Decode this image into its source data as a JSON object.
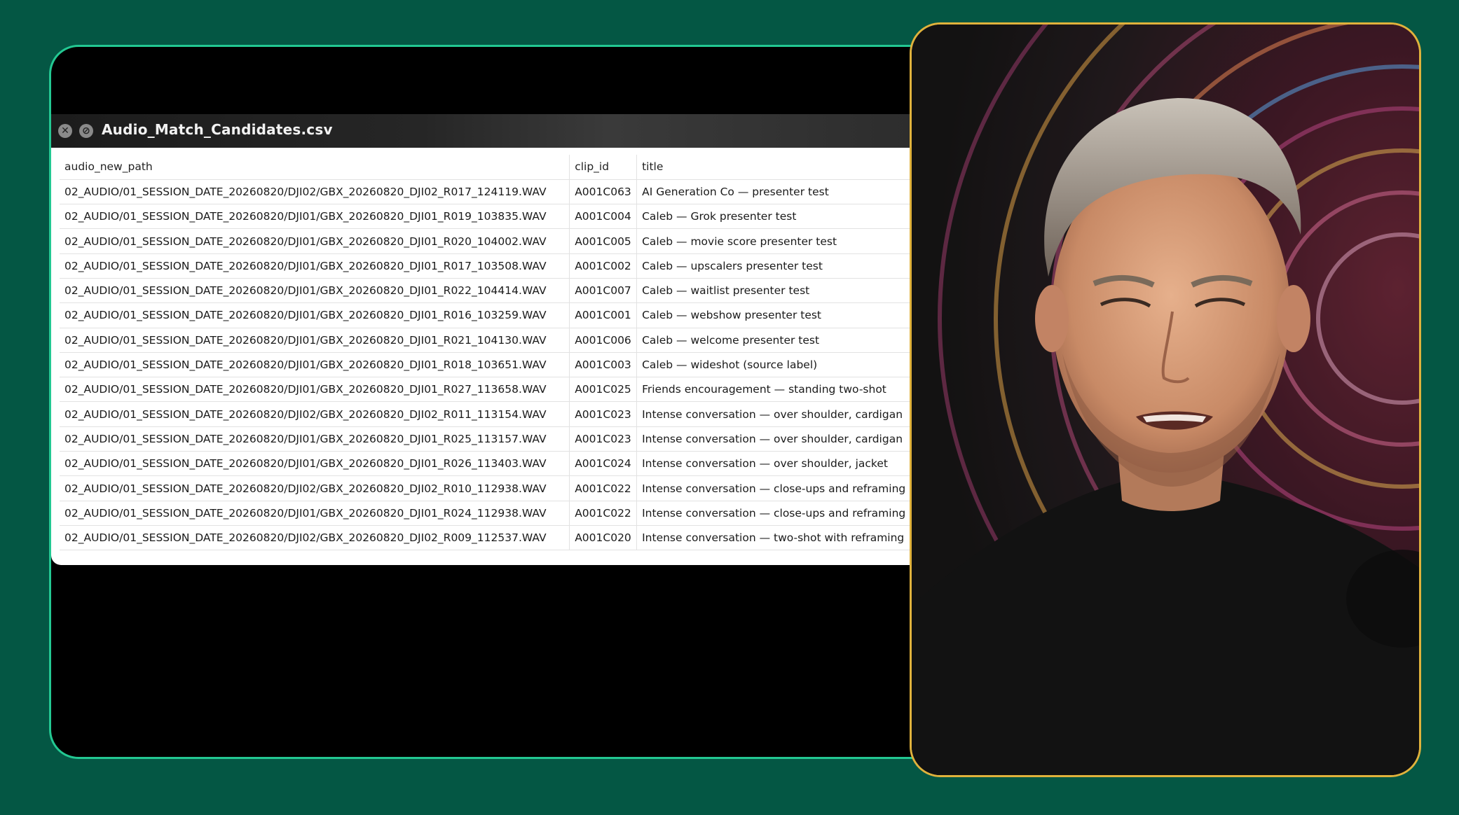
{
  "window": {
    "title": "Audio_Match_Candidates.csv",
    "close_glyph": "✕",
    "min_glyph": "⊘"
  },
  "table": {
    "headers": [
      "audio_new_path",
      "clip_id",
      "title"
    ],
    "rows": [
      [
        "02_AUDIO/01_SESSION_DATE_20260820/DJI02/GBX_20260820_DJI02_R017_124119.WAV",
        "A001C063",
        "AI Generation Co — presenter test"
      ],
      [
        "02_AUDIO/01_SESSION_DATE_20260820/DJI01/GBX_20260820_DJI01_R019_103835.WAV",
        "A001C004",
        "Caleb — Grok presenter test"
      ],
      [
        "02_AUDIO/01_SESSION_DATE_20260820/DJI01/GBX_20260820_DJI01_R020_104002.WAV",
        "A001C005",
        "Caleb — movie score presenter test"
      ],
      [
        "02_AUDIO/01_SESSION_DATE_20260820/DJI01/GBX_20260820_DJI01_R017_103508.WAV",
        "A001C002",
        "Caleb — upscalers presenter test"
      ],
      [
        "02_AUDIO/01_SESSION_DATE_20260820/DJI01/GBX_20260820_DJI01_R022_104414.WAV",
        "A001C007",
        "Caleb — waitlist presenter test"
      ],
      [
        "02_AUDIO/01_SESSION_DATE_20260820/DJI01/GBX_20260820_DJI01_R016_103259.WAV",
        "A001C001",
        "Caleb — webshow presenter test"
      ],
      [
        "02_AUDIO/01_SESSION_DATE_20260820/DJI01/GBX_20260820_DJI01_R021_104130.WAV",
        "A001C006",
        "Caleb — welcome presenter test"
      ],
      [
        "02_AUDIO/01_SESSION_DATE_20260820/DJI01/GBX_20260820_DJI01_R018_103651.WAV",
        "A001C003",
        "Caleb — wideshot (source label)"
      ],
      [
        "02_AUDIO/01_SESSION_DATE_20260820/DJI01/GBX_20260820_DJI01_R027_113658.WAV",
        "A001C025",
        "Friends encouragement — standing two-shot"
      ],
      [
        "02_AUDIO/01_SESSION_DATE_20260820/DJI02/GBX_20260820_DJI02_R011_113154.WAV",
        "A001C023",
        "Intense conversation — over shoulder, cardigan"
      ],
      [
        "02_AUDIO/01_SESSION_DATE_20260820/DJI01/GBX_20260820_DJI01_R025_113157.WAV",
        "A001C023",
        "Intense conversation — over shoulder, cardigan"
      ],
      [
        "02_AUDIO/01_SESSION_DATE_20260820/DJI01/GBX_20260820_DJI01_R026_113403.WAV",
        "A001C024",
        "Intense conversation — over shoulder, jacket"
      ],
      [
        "02_AUDIO/01_SESSION_DATE_20260820/DJI02/GBX_20260820_DJI02_R010_112938.WAV",
        "A001C022",
        "Intense conversation — close-ups and reframing"
      ],
      [
        "02_AUDIO/01_SESSION_DATE_20260820/DJI01/GBX_20260820_DJI01_R024_112938.WAV",
        "A001C022",
        "Intense conversation — close-ups and reframing"
      ],
      [
        "02_AUDIO/01_SESSION_DATE_20260820/DJI02/GBX_20260820_DJI02_R009_112537.WAV",
        "A001C020",
        "Intense conversation — two-shot with reframing"
      ]
    ]
  },
  "colors": {
    "background": "#045744",
    "screen_border": "#23c892",
    "cam_border": "#e0b23c"
  }
}
